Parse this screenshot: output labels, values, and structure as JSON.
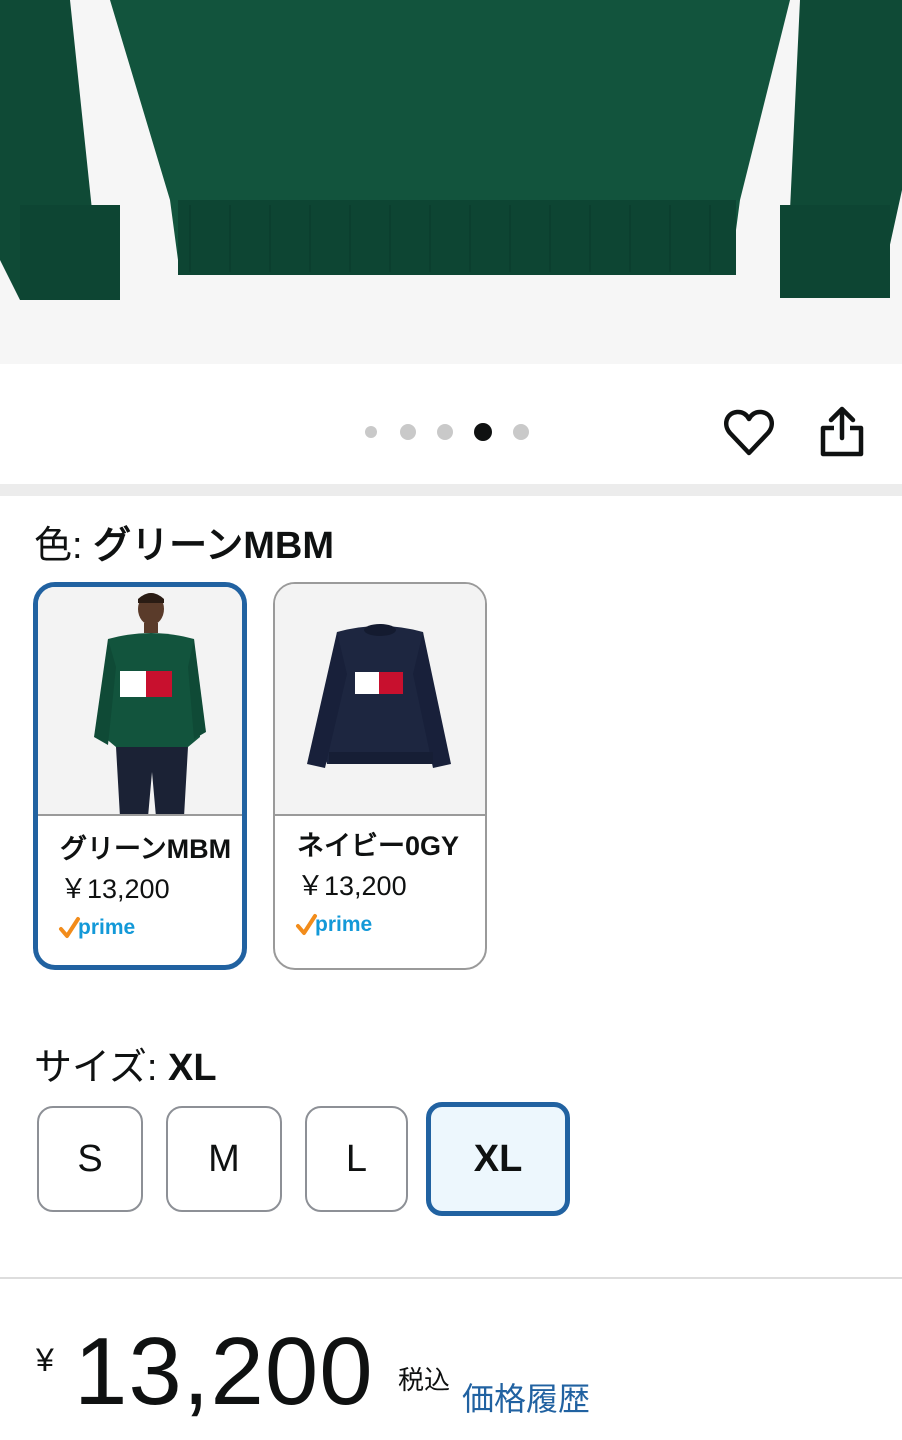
{
  "gallery": {
    "dot_count": 5,
    "active_index": 3
  },
  "actions": {
    "favorite_icon": "heart-outline-icon",
    "share_icon": "share-icon"
  },
  "color": {
    "label": "色:",
    "selected": "グリーンMBM",
    "options": [
      {
        "name": "グリーンMBM",
        "price": "￥13,200",
        "prime": "prime",
        "selected": true
      },
      {
        "name": "ネイビー0GY",
        "price": "￥13,200",
        "prime": "prime",
        "selected": false
      }
    ]
  },
  "size": {
    "label": "サイズ:",
    "selected": "XL",
    "options": [
      {
        "label": "S",
        "selected": false
      },
      {
        "label": "M",
        "selected": false
      },
      {
        "label": "L",
        "selected": false
      },
      {
        "label": "XL",
        "selected": true
      }
    ]
  },
  "price": {
    "currency": "¥",
    "amount": "13,200",
    "tax_note": "税込",
    "history_link": "価格履歴"
  },
  "colors": {
    "accent_blue": "#2162a1",
    "sweater_green": "#0f4a36",
    "sweater_navy": "#1d2640",
    "prime_orange": "#f28c1b",
    "prime_blue": "#1399d8"
  }
}
